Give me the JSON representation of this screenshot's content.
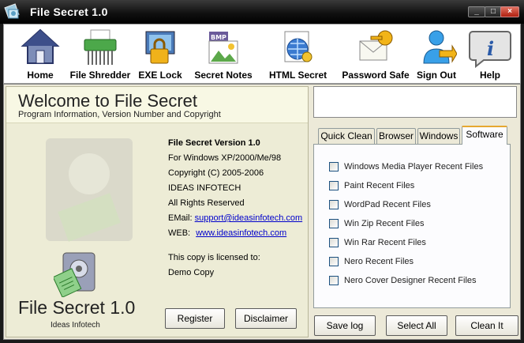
{
  "window": {
    "title": "File Secret 1.0",
    "controls": {
      "minimize": "_",
      "maximize": "□",
      "close": "×"
    }
  },
  "toolbar": {
    "items": [
      {
        "label": "Home",
        "icon": "home-icon"
      },
      {
        "label": "File Shredder",
        "icon": "shredder-icon"
      },
      {
        "label": "EXE Lock",
        "icon": "exe-lock-icon"
      },
      {
        "label": "Secret Notes",
        "icon": "secret-notes-icon"
      },
      {
        "label": "HTML Secret",
        "icon": "html-secret-icon"
      },
      {
        "label": "Password Safe",
        "icon": "password-safe-icon"
      },
      {
        "label": "Sign Out",
        "icon": "sign-out-icon"
      },
      {
        "label": "Help",
        "icon": "help-icon"
      }
    ]
  },
  "welcome": {
    "title": "Welcome  to File Secret",
    "subtitle": "Program Information, Version Number and Copyright"
  },
  "info": {
    "version": "File Secret Version 1.0",
    "platforms": "For Windows XP/2000/Me/98",
    "copyright": "Copyright (C) 2005-2006",
    "company": "IDEAS INFOTECH",
    "rights": "All Rights Reserved",
    "email_label": "EMail:",
    "email": "support@ideasinfotech.com",
    "web_label": "WEB:",
    "web": "www.ideasinfotech.com",
    "license_label": "This copy is licensed to:",
    "licensee": "Demo Copy"
  },
  "brand": {
    "name": "File Secret 1.0",
    "company": "Ideas Infotech"
  },
  "buttons": {
    "register": "Register",
    "disclaimer": "Disclaimer",
    "save_log": "Save log",
    "select_all": "Select All",
    "clean_it": "Clean It"
  },
  "tabs": [
    {
      "label": "Quick Clean",
      "active": false
    },
    {
      "label": "Browser",
      "active": false
    },
    {
      "label": "Windows",
      "active": false
    },
    {
      "label": "Software",
      "active": true
    }
  ],
  "software_items": [
    {
      "label": "Windows Media Player Recent Files",
      "checked": false
    },
    {
      "label": "Paint Recent Files",
      "checked": false
    },
    {
      "label": "WordPad Recent Files",
      "checked": false
    },
    {
      "label": "Win Zip Recent Files",
      "checked": false
    },
    {
      "label": "Win Rar Recent Files",
      "checked": false
    },
    {
      "label": "Nero Recent Files",
      "checked": false
    },
    {
      "label": "Nero Cover Designer Recent Files",
      "checked": false
    }
  ],
  "colors": {
    "titlebar": "#000000",
    "panel": "#ece9d8",
    "link": "#0000cc",
    "active_tab_accent": "#e6a830"
  }
}
